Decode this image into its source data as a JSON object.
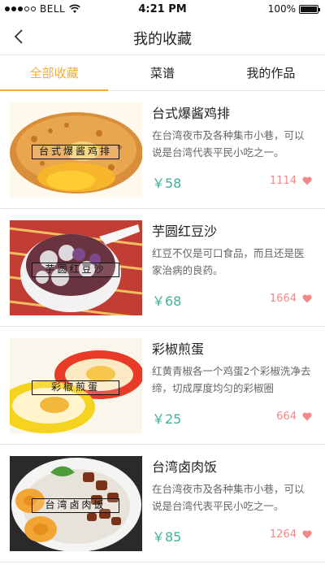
{
  "status_bar": {
    "carrier": "BELL",
    "time": "4:21 PM",
    "battery": "100%"
  },
  "nav": {
    "title": "我的收藏"
  },
  "tabs": [
    {
      "label": "全部收藏",
      "active": true
    },
    {
      "label": "菜谱",
      "active": false
    },
    {
      "label": "我的作品",
      "active": false
    }
  ],
  "items": [
    {
      "title": "台式爆酱鸡排",
      "desc": "在台湾夜市及各种集市小巷，可以说是台湾代表平民小吃之一。",
      "price": "￥58",
      "likes": "1114",
      "caption": "台式爆酱鸡排",
      "image": "fried-chicken-cutlet-icon"
    },
    {
      "title": "芋圆红豆沙",
      "desc": "红豆不仅是可口食品，而且还是医家治病的良药。",
      "price": "￥68",
      "likes": "1664",
      "caption": "芋圆红豆沙",
      "image": "taro-ball-red-bean-soup-icon"
    },
    {
      "title": "彩椒煎蛋",
      "desc": "红黄青椒各一个鸡蛋2个彩椒洗净去缔，切成厚度均匀的彩椒圈",
      "price": "￥25",
      "likes": "664",
      "caption": "彩椒煎蛋",
      "image": "pepper-egg-icon"
    },
    {
      "title": "台湾卤肉饭",
      "desc": "在台湾夜市及各种集市小巷，可以说是台湾代表平民小吃之一。",
      "price": "￥85",
      "likes": "1264",
      "caption": "台湾卤肉饭",
      "image": "braised-pork-rice-icon"
    }
  ],
  "colors": {
    "accent": "#f0ad3b",
    "price": "#3db39a",
    "likes": "#f08a8a"
  }
}
